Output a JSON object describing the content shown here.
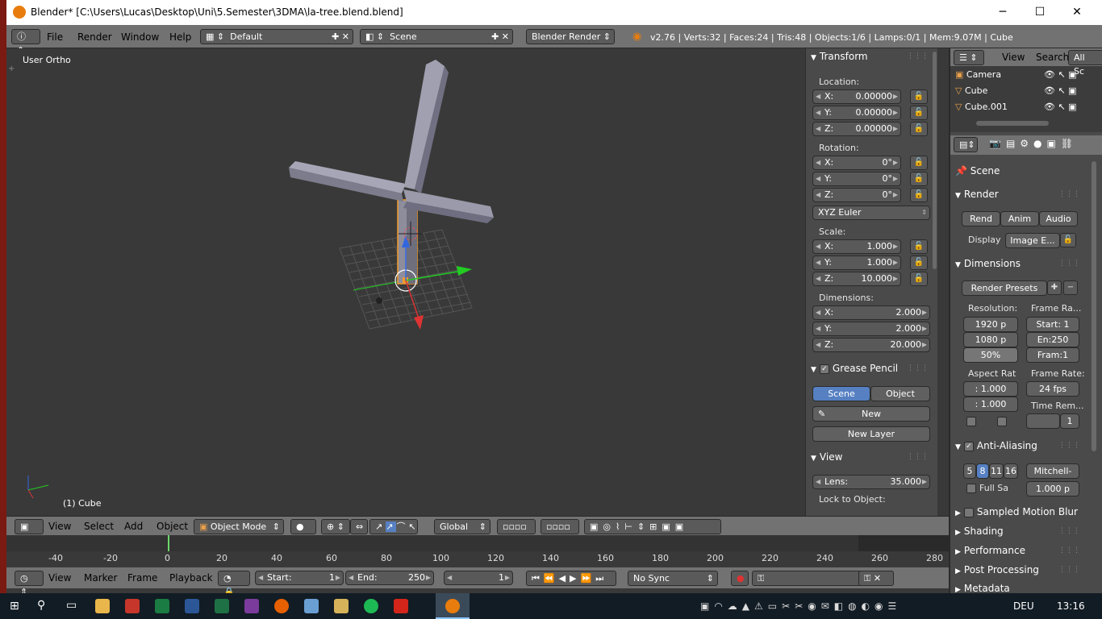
{
  "window": {
    "title": "Blender* [C:\\Users\\Lucas\\Desktop\\Uni\\5.Semester\\3DMA\\la-tree.blend.blend]",
    "min": "─",
    "max": "☐",
    "close": "✕"
  },
  "menu": {
    "file": "File",
    "render": "Render",
    "window": "Window",
    "help": "Help"
  },
  "layout": "Default",
  "scene": "Scene",
  "engine": "Blender Render",
  "stats": "v2.76 | Verts:32 | Faces:24 | Tris:48 | Objects:1/6 | Lamps:0/1 | Mem:9.07M | Cube",
  "viewport": {
    "label": "User Ortho",
    "object": "(1) Cube"
  },
  "transform": {
    "title": "Transform",
    "location_label": "Location:",
    "rotation_label": "Rotation:",
    "scale_label": "Scale:",
    "dimensions_label": "Dimensions:",
    "location": [
      {
        "k": "X:",
        "v": "0.00000"
      },
      {
        "k": "Y:",
        "v": "0.00000"
      },
      {
        "k": "Z:",
        "v": "0.00000"
      }
    ],
    "rotation": [
      {
        "k": "X:",
        "v": "0°"
      },
      {
        "k": "Y:",
        "v": "0°"
      },
      {
        "k": "Z:",
        "v": "0°"
      }
    ],
    "rotation_mode": "XYZ Euler",
    "scale": [
      {
        "k": "X:",
        "v": "1.000"
      },
      {
        "k": "Y:",
        "v": "1.000"
      },
      {
        "k": "Z:",
        "v": "10.000"
      }
    ],
    "dimensions": [
      {
        "k": "X:",
        "v": "2.000"
      },
      {
        "k": "Y:",
        "v": "2.000"
      },
      {
        "k": "Z:",
        "v": "20.000"
      }
    ]
  },
  "grease": {
    "title": "Grease Pencil",
    "scene": "Scene",
    "object": "Object",
    "new": "New",
    "new_layer": "New Layer"
  },
  "view": {
    "title": "View",
    "lens_k": "Lens:",
    "lens_v": "35.000",
    "lock": "Lock to Object:"
  },
  "outliner": {
    "view": "View",
    "search": "Search",
    "all": "All Sc",
    "items": [
      "Camera",
      "Cube",
      "Cube.001"
    ]
  },
  "props": {
    "scene": "Scene",
    "render": "Render",
    "rend": "Rend",
    "anim": "Anim",
    "audio": "Audio",
    "display": "Display",
    "display_val": "Image E...",
    "dimensions": "Dimensions",
    "presets": "Render Presets",
    "resolution": "Resolution:",
    "frame_range": "Frame Ra...",
    "res_x": "1920 p",
    "res_y": "1080 p",
    "res_pct": "50%",
    "start": "Start: 1",
    "end": "En:250",
    "step": "Fram:1",
    "aspect": "Aspect Rat",
    "frame_rate": "Frame Rate:",
    "asp_x": ": 1.000",
    "asp_y": ": 1.000",
    "fps": "24 fps",
    "time_rem": "Time Rem...",
    "tr_val": "1",
    "aa": "Anti-Aliasing",
    "aa_5": "5",
    "aa_8": "8",
    "aa_11": "11",
    "aa_16": "16",
    "filter": "Mitchell-",
    "full_sa": "Full Sa",
    "filter_size": "1.000 p",
    "sampled": "Sampled Motion Blur",
    "shading": "Shading",
    "performance": "Performance",
    "post": "Post Processing",
    "metadata": "Metadata"
  },
  "vhdr": {
    "view": "View",
    "select": "Select",
    "add": "Add",
    "object": "Object",
    "mode": "Object Mode",
    "orient": "Global"
  },
  "timeline": {
    "ticks": [
      "-40",
      "-20",
      "0",
      "20",
      "40",
      "60",
      "80",
      "100",
      "120",
      "140",
      "160",
      "180",
      "200",
      "220",
      "240",
      "260",
      "280"
    ]
  },
  "tlhdr": {
    "view": "View",
    "marker": "Marker",
    "frame": "Frame",
    "playback": "Playback",
    "start_k": "Start:",
    "start_v": "1",
    "end_k": "End:",
    "end_v": "250",
    "cur": "1",
    "sync": "No Sync"
  },
  "taskbar": {
    "lang": "DEU",
    "time": "13:16"
  },
  "colors": {
    "accent": "#5680c2",
    "x_axis": "#d33",
    "y_axis": "#2c2",
    "z_axis": "#36d",
    "select": "#f39a2b"
  }
}
